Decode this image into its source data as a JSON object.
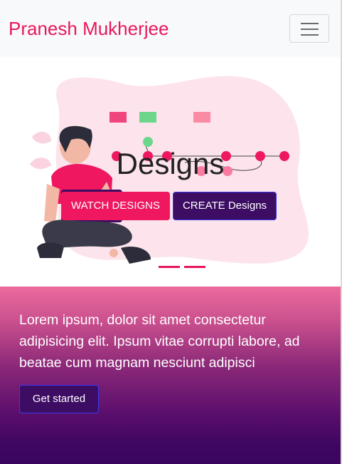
{
  "navbar": {
    "brand": "Pranesh Mukherjee",
    "toggler_icon": "hamburger-menu-icon"
  },
  "hero": {
    "title": "Designs",
    "watch_label": "WATCH DESIGNS",
    "create_label": "CREATE Designs",
    "illustration": "person-with-laptop-illustration",
    "slide_count": 2,
    "active_slide": 1
  },
  "promo": {
    "text": "Lorem ipsum, dolor sit amet consectetur adipisicing elit. Ipsum vitae corrupti labore, ad beatae cum magnam nesciunt adipisci",
    "cta_label": "Get started"
  },
  "colors": {
    "brand": "#e8175d",
    "primary_button": "#ee1760",
    "secondary_button": "#3d0c63",
    "gradient_top": "#eb6b9c",
    "gradient_bottom": "#3a0560"
  }
}
